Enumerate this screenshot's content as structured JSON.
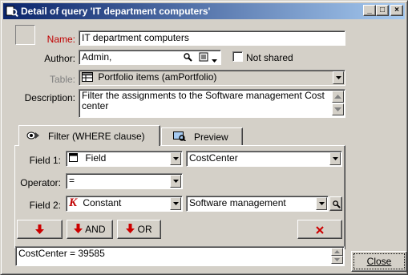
{
  "window": {
    "title": "Detail of query 'IT department computers'",
    "minimize": "_",
    "maximize": "□",
    "close": "×"
  },
  "form": {
    "name_label": "Name:",
    "name_value": "IT department computers",
    "author_label": "Author:",
    "author_value": "Admin,",
    "not_shared_label": "Not shared",
    "table_label": "Table:",
    "table_value": "Portfolio items (amPortfolio)",
    "description_label": "Description:",
    "description_line1": "Filter the assignments to the Software management Cost",
    "description_line2": "center"
  },
  "tabs": [
    {
      "label": "Filter (WHERE clause)"
    },
    {
      "label": "Preview"
    }
  ],
  "filter": {
    "field1_label": "Field 1:",
    "field1_type": "Field",
    "field1_value": "CostCenter",
    "operator_label": "Operator:",
    "operator_value": "=",
    "field2_label": "Field 2:",
    "field2_type": "Constant",
    "field2_value": "Software management",
    "and_label": "AND",
    "or_label": "OR",
    "expression": "CostCenter = 39585"
  },
  "buttons": {
    "close_label": "Close"
  },
  "colors": {
    "accent_red": "#cc0000",
    "title_blue": "#0a246a"
  }
}
